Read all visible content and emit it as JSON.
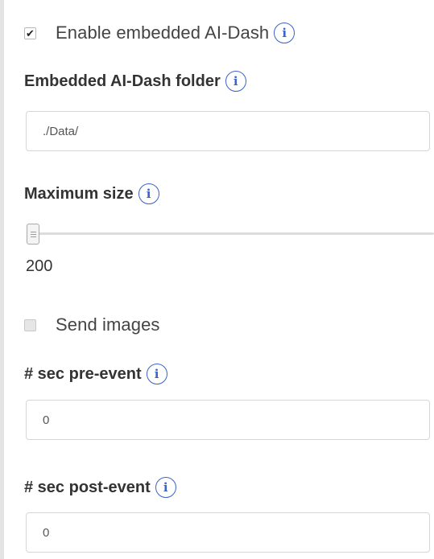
{
  "embedded": {
    "enabled": true,
    "enable_label": "Enable embedded AI-Dash",
    "folder_label": "Embedded AI-Dash folder",
    "folder_value": "./Data/"
  },
  "max_size": {
    "label": "Maximum size",
    "value": "200",
    "slider_fraction": 0
  },
  "send_images": {
    "checked": false,
    "label": "Send images"
  },
  "pre_event": {
    "label": "# sec pre-event",
    "value": "0"
  },
  "post_event": {
    "label": "# sec post-event",
    "value": "0"
  },
  "info_glyph": "i",
  "colors": {
    "info_accent": "#3a63c8",
    "input_border": "#d6d6d6"
  }
}
